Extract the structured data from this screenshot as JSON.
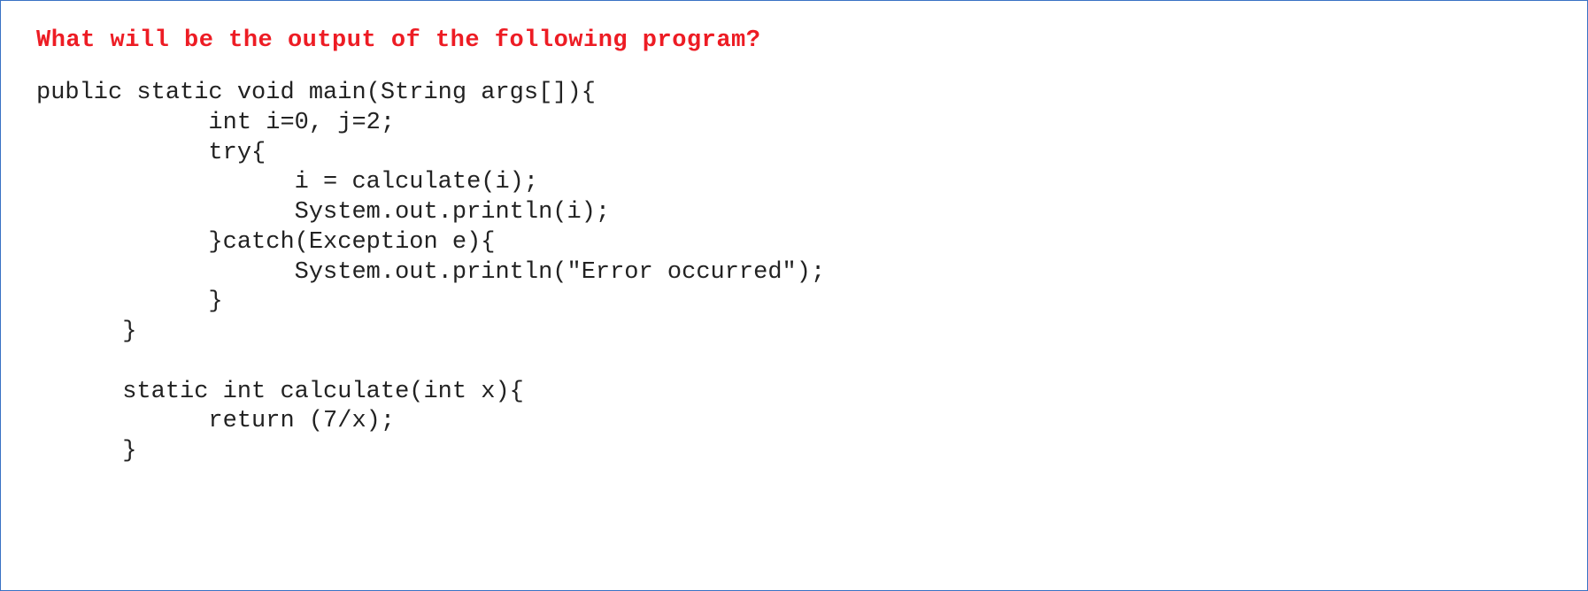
{
  "question": {
    "title": "What will be the output of the following program?"
  },
  "code": {
    "line1": "public static void main(String args[]){",
    "line2": "            int i=0, j=2;",
    "line3": "            try{",
    "line4": "                  i = calculate(i);",
    "line5": "                  System.out.println(i);",
    "line6": "            }catch(Exception e){",
    "line7": "                  System.out.println(\"Error occurred\");",
    "line8": "            }",
    "line9": "      }",
    "line10": "",
    "line11": "      static int calculate(int x){",
    "line12": "            return (7/x);",
    "line13": "      }"
  }
}
